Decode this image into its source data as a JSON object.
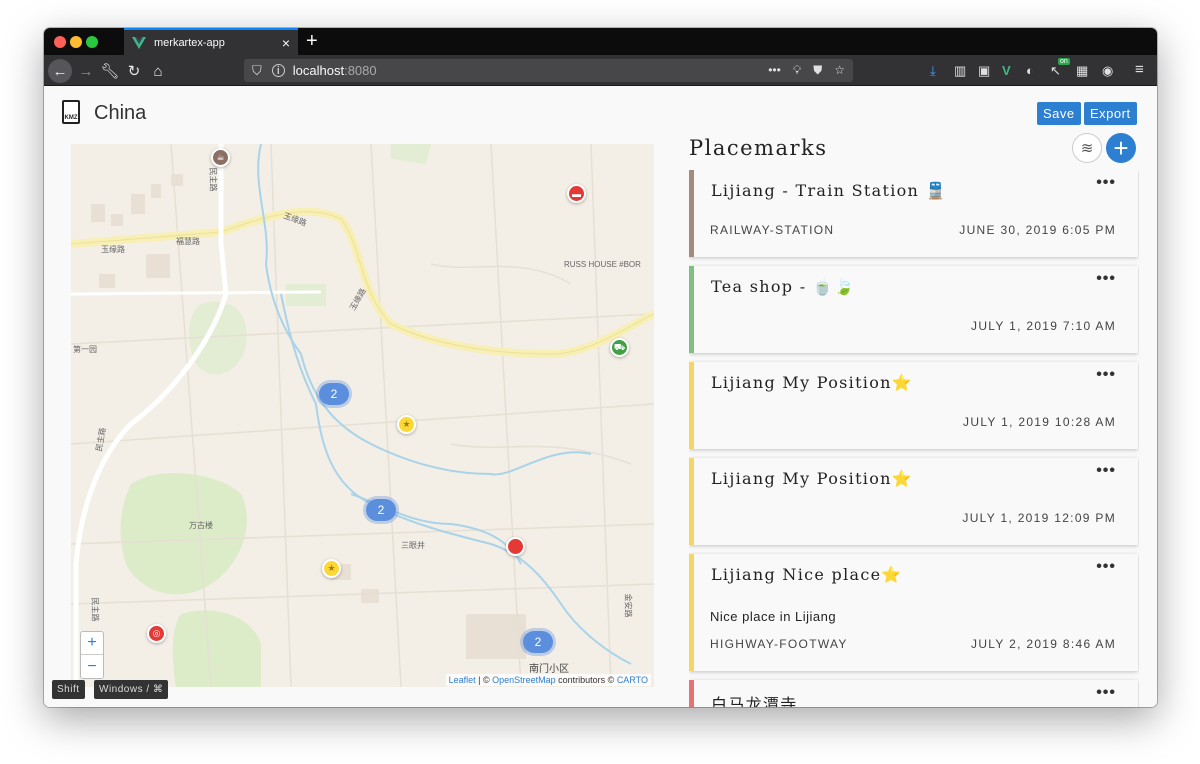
{
  "browser": {
    "tab_title": "merkartex-app",
    "url_host": "localhost",
    "url_port": ":8080",
    "badge_on": "on"
  },
  "app": {
    "document_title": "China",
    "save_label": "Save",
    "export_label": "Export",
    "placemarks_heading": "Placemarks",
    "add_symbol": "+"
  },
  "map": {
    "zoom_in": "+",
    "zoom_out": "−",
    "attribution_leaflet": "Leaflet",
    "attribution_sep": " | © ",
    "attribution_osm": "OpenStreetMap",
    "attribution_contrib": " contributors © ",
    "attribution_carto": "CARTO",
    "labels": {
      "road_yuyuan": "玉缘路",
      "road_fuhui": "福慧路",
      "road_yuyuan2": "玉缘路",
      "road_yuyuan3": "玉缘路",
      "road_minzhu": "民主路",
      "road_minzhu2": "民主路",
      "road_minzhu3": "民主路",
      "russ_house": "RUSS HOUSE #BOR",
      "wangu": "万古楼",
      "sanyanjing": "三眼井",
      "nanmen": "南门小区",
      "yiyi": "第一园",
      "east": "金安路"
    },
    "clusters": [
      "2",
      "2",
      "2"
    ]
  },
  "shortcuts": {
    "shift": "Shift",
    "windows": "Windows / ⌘"
  },
  "placemarks": [
    {
      "name": "Lijiang - Train Station 🚆",
      "type": "RAILWAY-STATION",
      "date": "JUNE 30, 2019 6:05 PM",
      "desc": "",
      "color": "#a18b7e"
    },
    {
      "name": "Tea shop - 🍵🍃",
      "type": "",
      "date": "JULY 1, 2019 7:10 AM",
      "desc": "",
      "color": "#7fbf7f"
    },
    {
      "name": "Lijiang My Position⭐",
      "type": "",
      "date": "JULY 1, 2019 10:28 AM",
      "desc": "",
      "color": "#f5d565"
    },
    {
      "name": "Lijiang My Position⭐",
      "type": "",
      "date": "JULY 1, 2019 12:09 PM",
      "desc": "",
      "color": "#f5d565"
    },
    {
      "name": "Lijiang Nice place⭐",
      "type": "HIGHWAY-FOOTWAY",
      "date": "JULY 2, 2019 8:46 AM",
      "desc": "Nice place in Lijiang",
      "color": "#f5d565"
    },
    {
      "name": "白马龙潭寺",
      "type": "",
      "date": "",
      "desc": "",
      "color": "#e57373"
    }
  ],
  "menu_symbol": "•••"
}
